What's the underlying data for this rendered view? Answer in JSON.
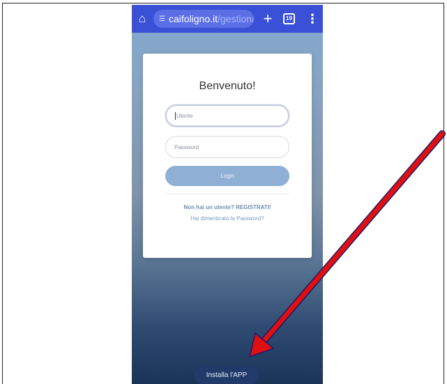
{
  "browser": {
    "url_host": "caifoligno.it",
    "url_path": "/gestionale/f",
    "tab_count": "19",
    "plus_glyph": "+",
    "menu_glyph": "⋮",
    "home_glyph": "⌂",
    "tune_glyph": "☰"
  },
  "login": {
    "title": "Benvenuto!",
    "username_placeholder": "Utente",
    "password_placeholder": "Password",
    "login_label": "Login",
    "register_text": "Non hai un utente? REGISTRATI!",
    "forgot_text": "Hai dimenticato la Password?"
  },
  "install": {
    "label": "Installa l'APP"
  },
  "colors": {
    "chrome_bar": "#3a50d6",
    "annotation_arrow": "#e01010",
    "login_button": "#8fb0d4"
  }
}
